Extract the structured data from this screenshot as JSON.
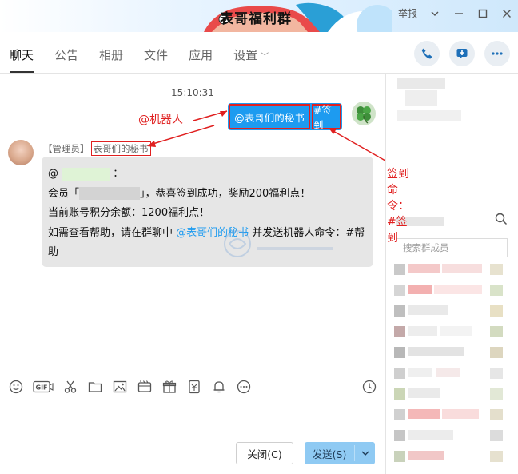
{
  "window": {
    "title": "表哥福利群",
    "report_label": "举报"
  },
  "tabs": [
    {
      "label": "聊天",
      "active": true
    },
    {
      "label": "公告",
      "active": false
    },
    {
      "label": "相册",
      "active": false
    },
    {
      "label": "文件",
      "active": false
    },
    {
      "label": "应用",
      "active": false
    },
    {
      "label": "设置",
      "active": false
    }
  ],
  "chat": {
    "timestamp": "15:10:31",
    "my_message": {
      "mention": "@表哥们的秘书",
      "command": "#签到"
    },
    "bot_message": {
      "role_tag": "【管理员】",
      "sender": "表哥们的秘书",
      "line1_prefix": "@",
      "line1_suffix": "：",
      "line2_prefix": "会员「",
      "line2_suffix": "」，恭喜签到成功，奖励200福利点！",
      "line3": "当前账号积分余额：1200福利点！",
      "line4_prefix": "如需查看帮助，请在群聊中 ",
      "line4_mention": "@表哥们的秘书",
      "line4_suffix": " 并发送机器人命令：#帮助"
    }
  },
  "annotations": {
    "robot": "@机器人",
    "command": "签到命令：#签到"
  },
  "input": {
    "close_label": "关闭(C)",
    "send_label": "发送(S)"
  },
  "members": {
    "search_placeholder": "搜索群成员"
  },
  "colors": {
    "accent": "#1d9bf0",
    "annotation": "#e02020",
    "send_button": "#8fcaf3"
  }
}
